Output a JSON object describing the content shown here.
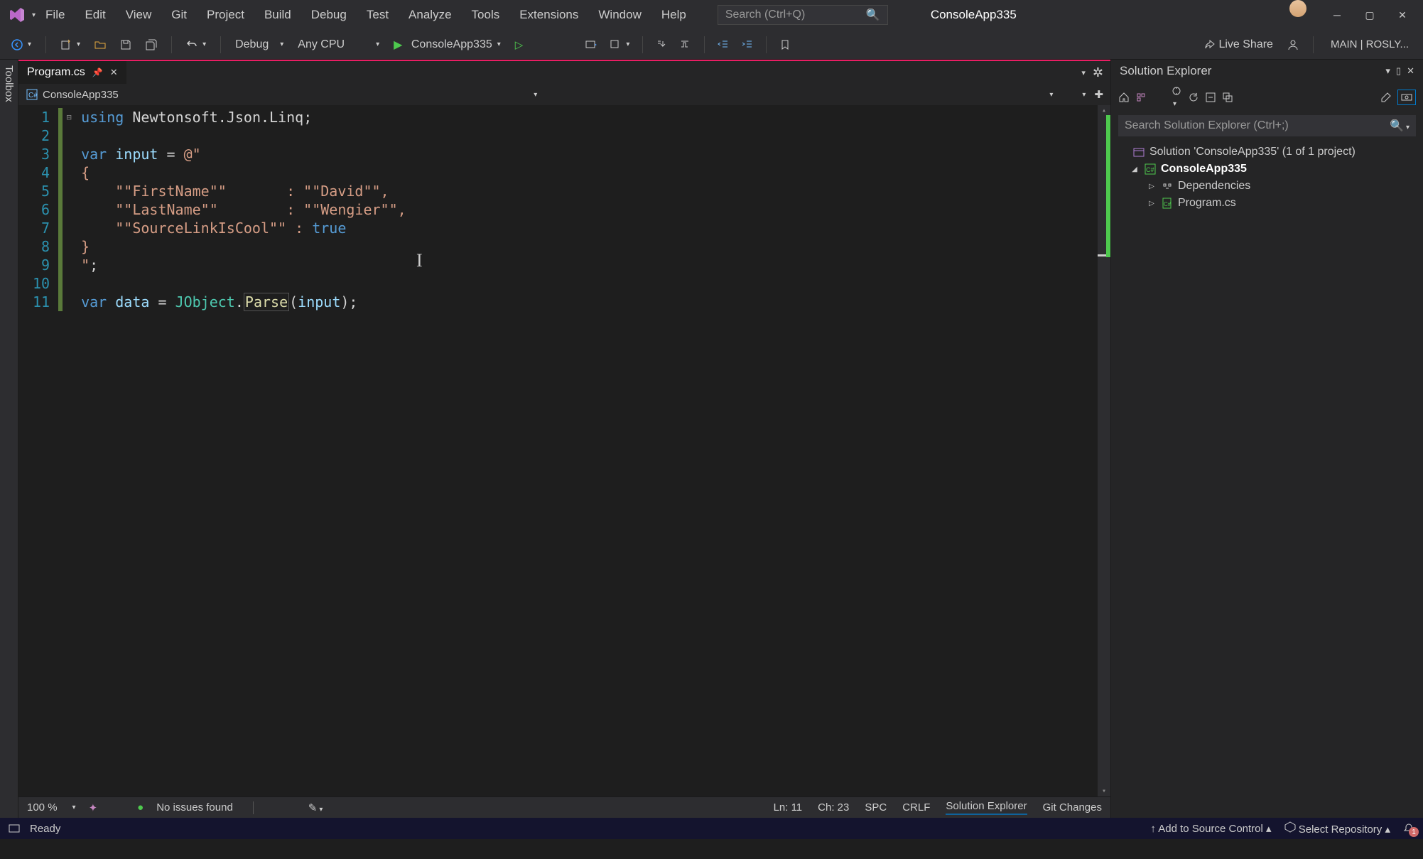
{
  "title": "ConsoleApp335",
  "menu": [
    "File",
    "Edit",
    "View",
    "Git",
    "Project",
    "Build",
    "Debug",
    "Test",
    "Analyze",
    "Tools",
    "Extensions",
    "Window",
    "Help"
  ],
  "search_placeholder": "Search (Ctrl+Q)",
  "toolbar": {
    "config": "Debug",
    "platform": "Any CPU",
    "run_target": "ConsoleApp335",
    "live_share": "Live Share",
    "branch": "MAIN | ROSLY..."
  },
  "toolbox_label": "Toolbox",
  "tab": {
    "name": "Program.cs"
  },
  "navbar": {
    "project": "ConsoleApp335"
  },
  "code": {
    "lines": [
      "1",
      "2",
      "3",
      "4",
      "5",
      "6",
      "7",
      "8",
      "9",
      "10",
      "11"
    ],
    "l1_using": "using",
    "l1_ns": "Newtonsoft",
    "l1_json": "Json",
    "l1_linq": "Linq",
    "l3_var": "var",
    "l3_input": "input",
    "l3_eq": " = ",
    "l3_at": "@\"",
    "l4": "{",
    "l5_a": "    \"\"FirstName\"\"",
    "l5_colon": "       : ",
    "l5_b": "\"\"David\"\"",
    "l5_c": ",",
    "l6_a": "    \"\"LastName\"\"",
    "l6_colon": "        : ",
    "l6_b": "\"\"Wengier\"\"",
    "l6_c": ",",
    "l7_a": "    \"\"SourceLinkIsCool\"\"",
    "l7_colon": " : ",
    "l7_b": "true",
    "l8": "}",
    "l9": "\"",
    "l9_sc": ";",
    "l11_var": "var",
    "l11_data": "data",
    "l11_eq": " = ",
    "l11_jo": "JObject",
    "l11_dot": ".",
    "l11_parse": "Parse",
    "l11_open": "(",
    "l11_arg": "input",
    "l11_close": ");"
  },
  "solution_explorer": {
    "title": "Solution Explorer",
    "search_placeholder": "Search Solution Explorer (Ctrl+;)",
    "solution": "Solution 'ConsoleApp335' (1 of 1 project)",
    "project": "ConsoleApp335",
    "dependencies": "Dependencies",
    "file": "Program.cs"
  },
  "bottom_bar": {
    "zoom": "100 %",
    "issues": "No issues found",
    "ln": "Ln: 11",
    "ch": "Ch: 23",
    "spc": "SPC",
    "crlf": "CRLF",
    "tab1": "Solution Explorer",
    "tab2": "Git Changes"
  },
  "status": {
    "ready": "Ready",
    "add_source": "Add to Source Control",
    "select_repo": "Select Repository",
    "bell_count": "1"
  }
}
